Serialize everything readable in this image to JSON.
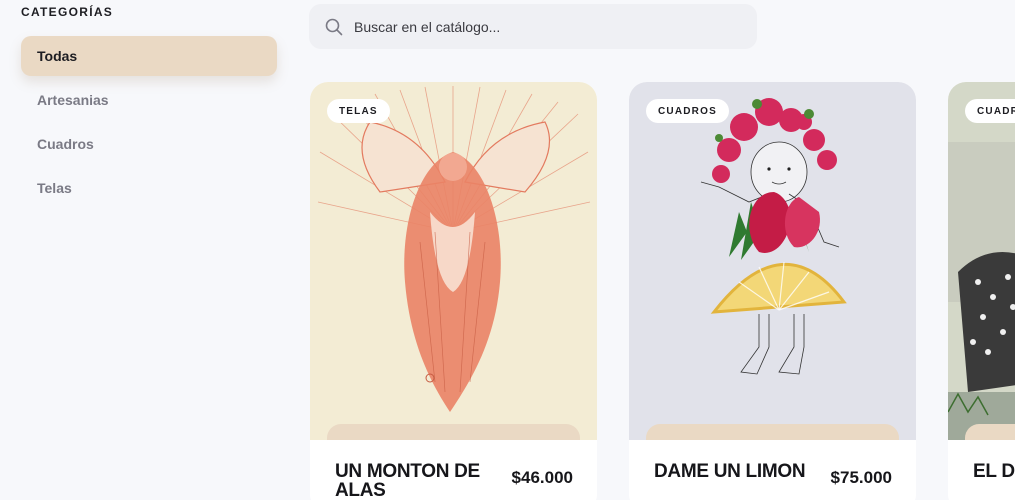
{
  "sidebar": {
    "heading": "CATEGORÍAS",
    "items": [
      {
        "label": "Todas"
      },
      {
        "label": "Artesanias"
      },
      {
        "label": "Cuadros"
      },
      {
        "label": "Telas"
      }
    ]
  },
  "search": {
    "placeholder": "Buscar en el catálogo..."
  },
  "products": [
    {
      "category": "TELAS",
      "title": "UN MONTON DE ALAS",
      "price": "$46.000"
    },
    {
      "category": "CUADROS",
      "title": "DAME UN LIMON",
      "price": "$75.000"
    },
    {
      "category": "CUADROS",
      "title": "EL DE ORIE",
      "price": ""
    }
  ],
  "colors": {
    "accent": "#ead9c4",
    "background": "#f7f8fb"
  }
}
